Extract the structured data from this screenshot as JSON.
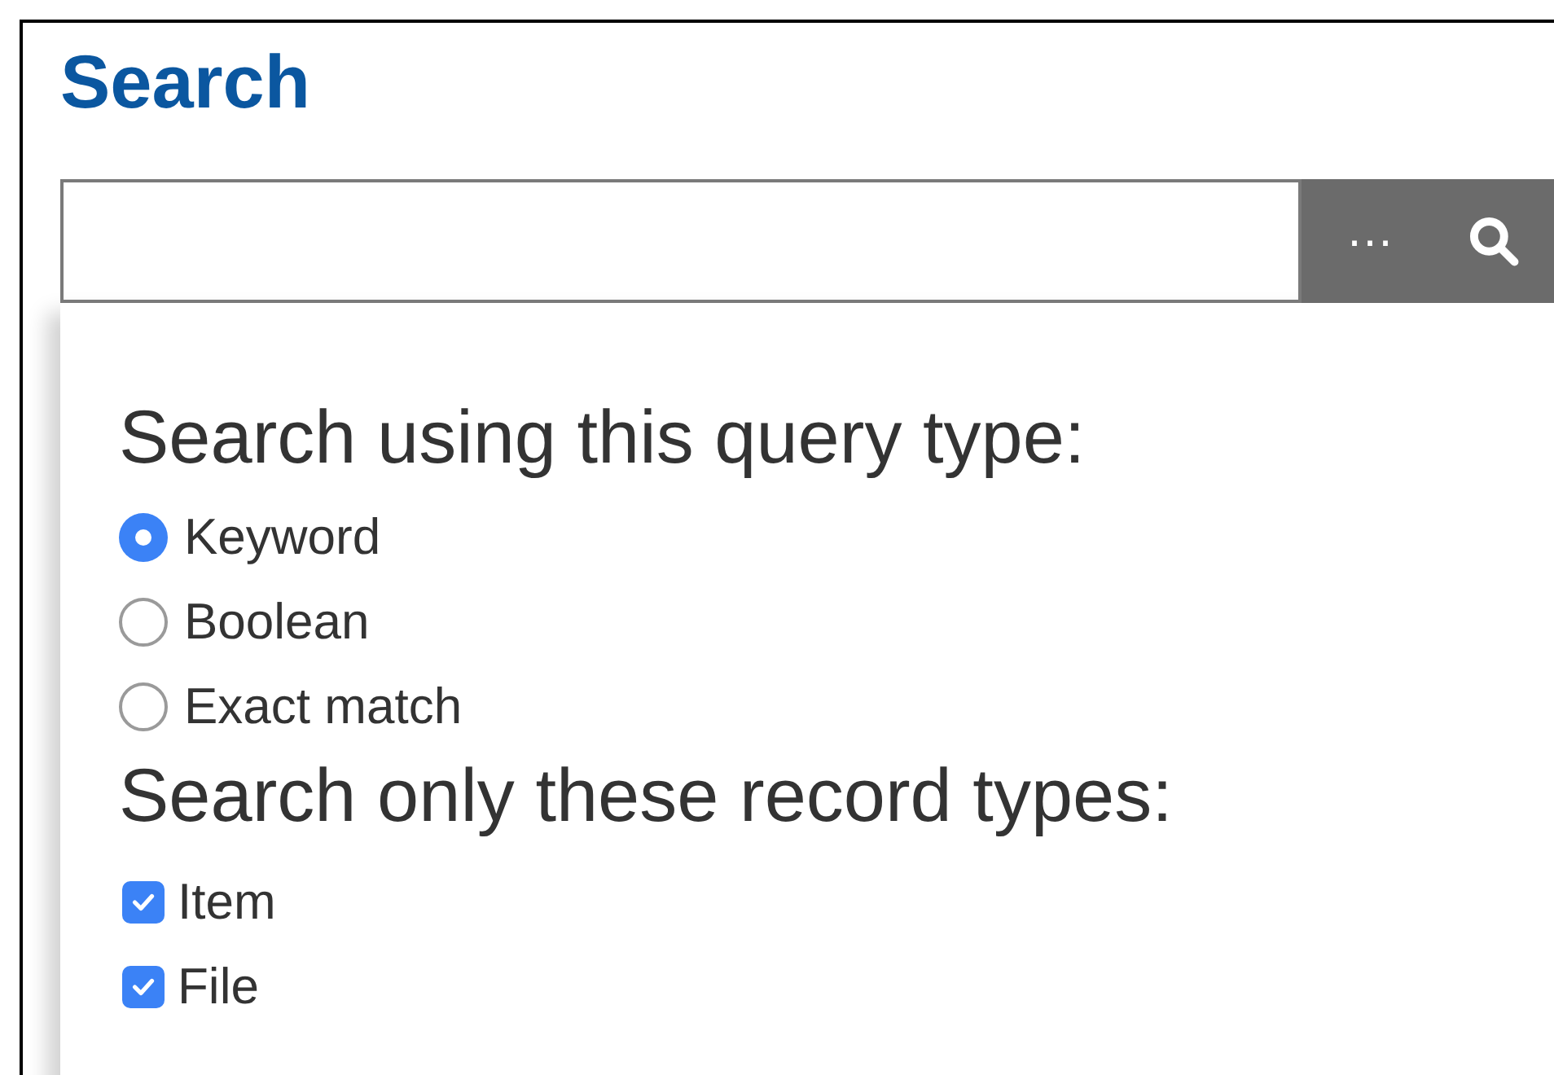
{
  "title": "Search",
  "search": {
    "ellipsis": "…"
  },
  "query_type": {
    "heading": "Search using this query type:",
    "options": [
      {
        "label": "Keyword",
        "selected": true
      },
      {
        "label": "Boolean",
        "selected": false
      },
      {
        "label": "Exact match",
        "selected": false
      }
    ]
  },
  "record_types": {
    "heading": "Search only these record types:",
    "options": [
      {
        "label": "Item",
        "checked": true
      },
      {
        "label": "File",
        "checked": true
      }
    ]
  }
}
